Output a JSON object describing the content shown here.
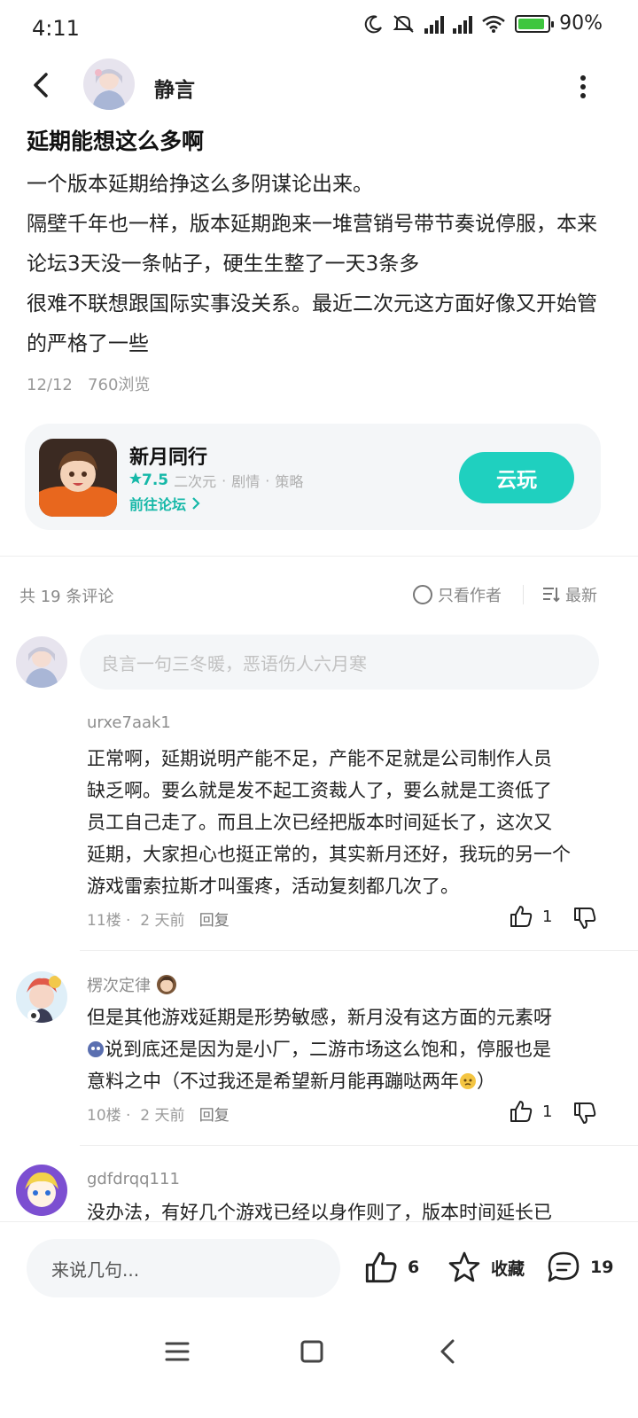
{
  "status_bar": {
    "time": "4:11",
    "battery": "90%",
    "battery_level": 0.9
  },
  "header": {
    "author_name": "静言"
  },
  "post": {
    "title": "延期能想这么多啊",
    "paragraphs": [
      "一个版本延期给挣这么多阴谋论出来。",
      "隔壁千年也一样，版本延期跑来一堆营销号带节奏说停服，本来论坛3天没一条帖子，硬生生整了一天3条多",
      "很难不联想跟国际实事没关系。最近二次元这方面好像又开始管的严格了一些"
    ],
    "date": "12/12",
    "views": "760浏览"
  },
  "game_card": {
    "name": "新月同行",
    "score": "7.5",
    "tags": [
      "二次元",
      "剧情",
      "策略"
    ],
    "forum_link": "前往论坛",
    "play_button": "云玩",
    "accent": "#1fd0bf"
  },
  "comments_header": {
    "count_text": "共 19 条评论",
    "only_author": "只看作者",
    "sort": "最新"
  },
  "reply_input": {
    "placeholder": "良言一句三冬暖，恶语伤人六月寒"
  },
  "comments": [
    {
      "user": "urxe7aak1",
      "lines": [
        "正常啊，延期说明产能不足，产能不足就是公司制作人员",
        "缺乏啊。要么就是发不起工资裁人了，要么就是工资低了",
        "员工自己走了。而且上次已经把版本时间延长了，这次又",
        "延期，大家担心也挺正常的，其实新月还好，我玩的另一个",
        "游戏雷索拉斯才叫蛋疼，活动复刻都几次了。"
      ],
      "floor": "11楼",
      "time": "2 天前",
      "reply": "回复",
      "likes": "1"
    },
    {
      "user": "楞次定律",
      "lines": [
        "但是其他游戏延期是形势敏感，新月没有这方面的元素呀",
        "说到底还是因为是小厂，二游市场这么饱和，停服也是",
        "意料之中（不过我还是希望新月能再蹦哒两年",
        "）"
      ],
      "floor": "10楼",
      "time": "2 天前",
      "reply": "回复",
      "likes": "1"
    },
    {
      "user": "gdfdrqq111",
      "lines": [
        "没办法，有好几个游戏已经以身作则了，版本时间延长已"
      ]
    }
  ],
  "bottom_bar": {
    "input_placeholder": "来说几句...",
    "likes": "6",
    "favorite": "收藏",
    "comments": "19"
  }
}
